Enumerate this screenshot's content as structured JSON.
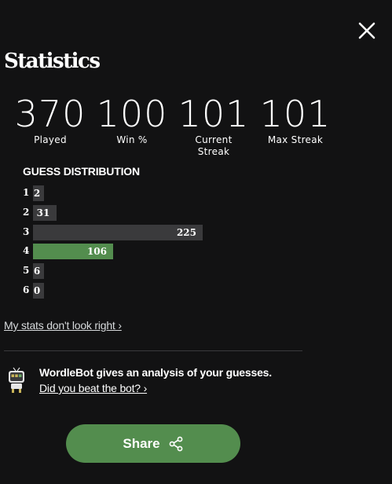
{
  "modal": {
    "title": "Statistics"
  },
  "stats": [
    {
      "value": "370",
      "label": "Played"
    },
    {
      "value": "100",
      "label": "Win %"
    },
    {
      "value": "101",
      "label": "Current\nStreak"
    },
    {
      "value": "101",
      "label": "Max Streak"
    }
  ],
  "distribution": {
    "title": "GUESS DISTRIBUTION",
    "rows": [
      {
        "guess": "1",
        "count": 2
      },
      {
        "guess": "2",
        "count": 31
      },
      {
        "guess": "3",
        "count": 225
      },
      {
        "guess": "4",
        "count": 106,
        "highlight": true
      },
      {
        "guess": "5",
        "count": 6
      },
      {
        "guess": "6",
        "count": 0
      }
    ]
  },
  "links": {
    "stats_wrong": "My stats don't look right ›"
  },
  "wordlebot": {
    "text": "WordleBot gives an analysis of your guesses.",
    "link": "Did you beat the bot? ›",
    "icon": "robot-icon"
  },
  "share": {
    "label": "Share",
    "icon": "share-icon"
  },
  "colors": {
    "background": "#121213",
    "bar": "#3a3a3c",
    "highlight": "#538d4e",
    "text": "#ffffff"
  }
}
